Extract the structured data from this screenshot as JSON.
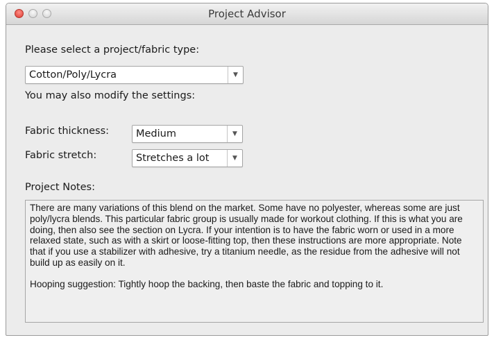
{
  "window": {
    "title": "Project Advisor"
  },
  "form": {
    "project_type_label": "Please select a project/fabric type:",
    "project_type_value": "Cotton/Poly/Lycra",
    "modify_label": "You may also modify the settings:",
    "thickness_label": "Fabric thickness:",
    "thickness_value": "Medium",
    "stretch_label": "Fabric stretch:",
    "stretch_value": "Stretches a lot",
    "notes_label": "Project Notes:"
  },
  "notes": {
    "paragraph1": "There are many variations of this blend on the market. Some have no polyester, whereas some are just poly/lycra blends. This particular fabric group is usually made for workout clothing. If this is what you are doing, then also see the section on Lycra. If your intention is to have the fabric worn or used in a more relaxed state, such as with a skirt or loose-fitting top, then these instructions are more appropriate. Note that if you use a stabilizer with adhesive, try a titanium needle, as the residue from the adhesive will not build up as easily on it.",
    "paragraph2": "Hooping suggestion: Tightly hoop the backing, then baste the fabric and topping to it."
  },
  "icons": {
    "close": "close-traffic-light-icon",
    "minimize": "minimize-traffic-light-icon",
    "maximize": "maximize-traffic-light-icon",
    "dropdown": "chevron-down-icon"
  },
  "colors": {
    "close_light": "#dd3b32",
    "window_bg": "#ececec",
    "notes_bg": "#efefef"
  }
}
